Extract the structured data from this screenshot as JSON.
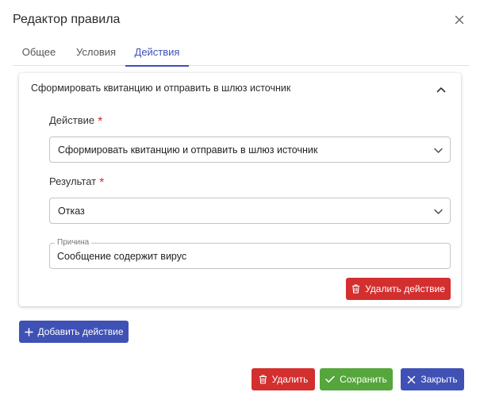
{
  "dialog": {
    "title": "Редактор правила"
  },
  "tabs": [
    {
      "label": "Общее",
      "active": false
    },
    {
      "label": "Условия",
      "active": false
    },
    {
      "label": "Действия",
      "active": true
    }
  ],
  "action_card": {
    "title": "Сформировать квитанцию и отправить в шлюз источник",
    "action_field": {
      "label": "Действие",
      "required_mark": "*",
      "value": "Сформировать квитанцию и отправить в шлюз источник"
    },
    "result_field": {
      "label": "Результат",
      "required_mark": "*",
      "value": "Отказ"
    },
    "reason_field": {
      "label": "Причина",
      "value": "Сообщение содержит вирус"
    },
    "delete_action_label": "Удалить действие"
  },
  "add_action_label": "Добавить действие",
  "footer": {
    "delete_label": "Удалить",
    "save_label": "Сохранить",
    "close_label": "Закрыть"
  },
  "colors": {
    "primary": "#3f51b5",
    "danger": "#d32f2f",
    "success": "#55a63b",
    "required": "#d32f2f"
  },
  "icons": {
    "close": "close-icon",
    "collapse": "chevron-up-icon",
    "dropdown": "chevron-down-icon",
    "trash": "trash-icon",
    "plus": "plus-icon",
    "check": "check-icon"
  }
}
